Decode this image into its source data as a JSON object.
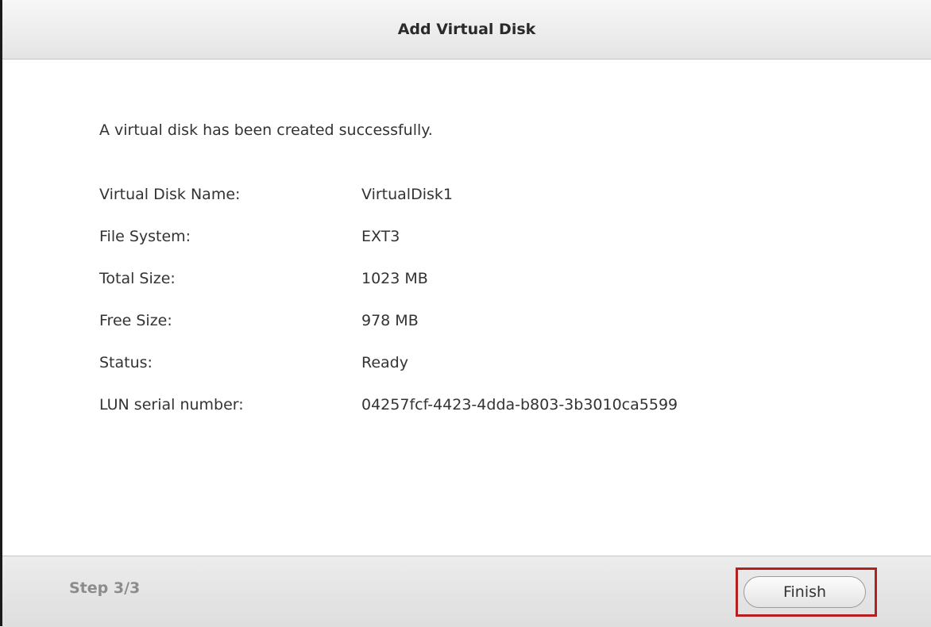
{
  "dialog": {
    "title": "Add Virtual Disk"
  },
  "content": {
    "message": "A virtual disk has been created successfully.",
    "details": [
      {
        "label": "Virtual Disk Name:",
        "value": "VirtualDisk1"
      },
      {
        "label": "File System:",
        "value": "EXT3"
      },
      {
        "label": "Total Size:",
        "value": "1023 MB"
      },
      {
        "label": "Free Size:",
        "value": "978 MB"
      },
      {
        "label": "Status:",
        "value": "Ready"
      },
      {
        "label": "LUN serial number:",
        "value": "04257fcf-4423-4dda-b803-3b3010ca5599"
      }
    ]
  },
  "footer": {
    "step": "Step 3/3",
    "finish_label": "Finish"
  },
  "colors": {
    "highlight": "#b41f1f",
    "title_text": "#2a2a2a",
    "step_text": "#8c8c8c"
  }
}
